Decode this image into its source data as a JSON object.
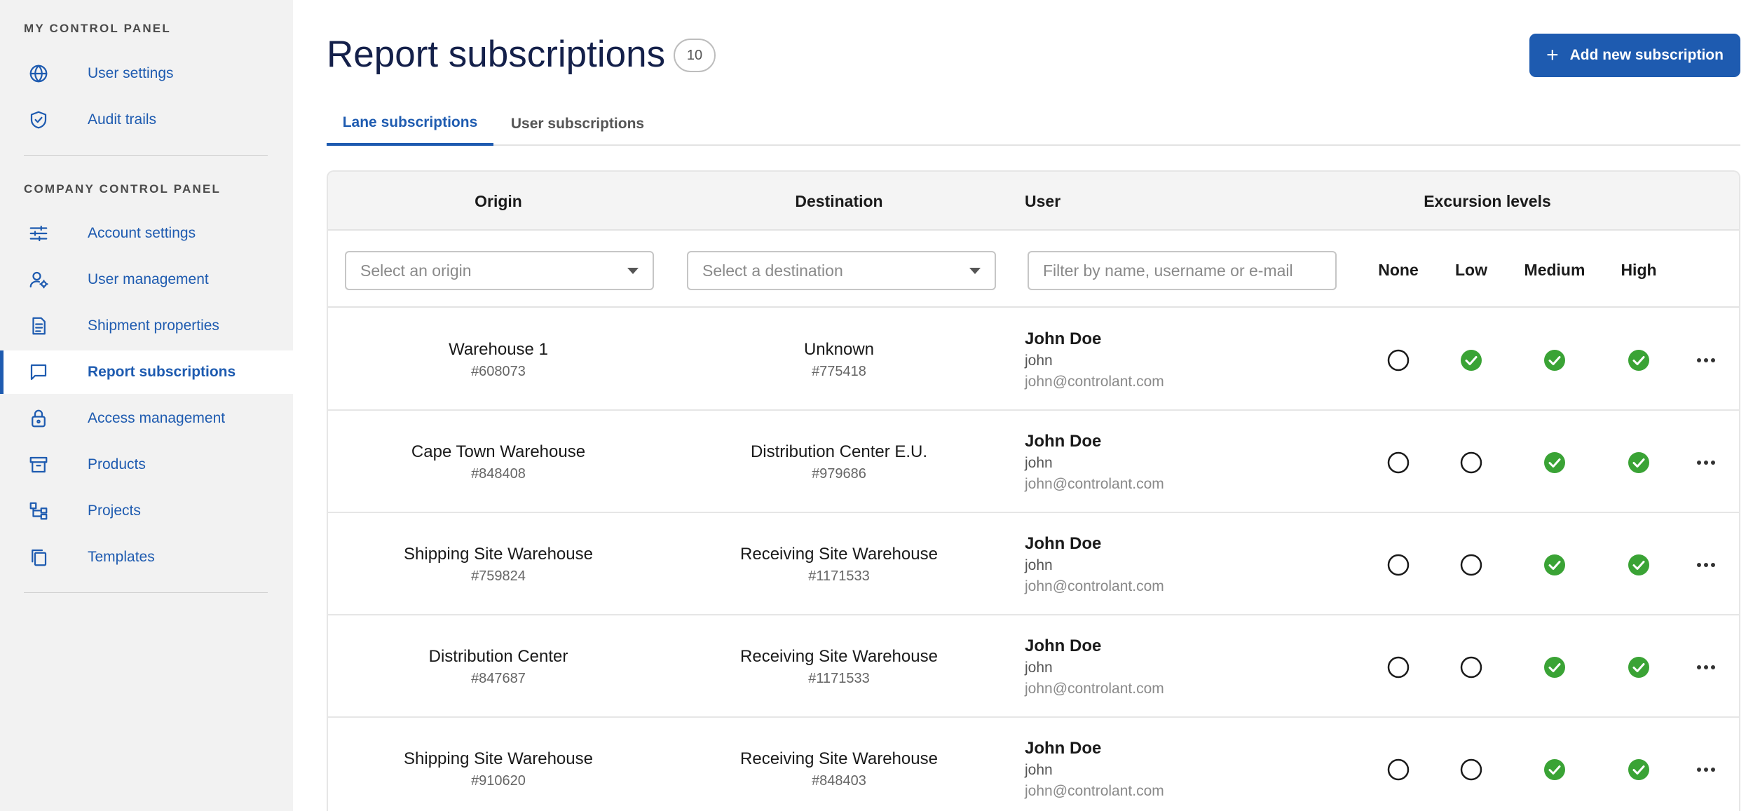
{
  "sidebar": {
    "my_section_title": "MY CONTROL PANEL",
    "my_items": [
      {
        "label": "User settings",
        "icon": "globe-icon"
      },
      {
        "label": "Audit trails",
        "icon": "shield-check-icon"
      }
    ],
    "company_section_title": "COMPANY CONTROL PANEL",
    "company_items": [
      {
        "label": "Account settings",
        "icon": "sliders-icon"
      },
      {
        "label": "User management",
        "icon": "user-gear-icon"
      },
      {
        "label": "Shipment properties",
        "icon": "document-icon"
      },
      {
        "label": "Report subscriptions",
        "icon": "message-square-icon",
        "active": true
      },
      {
        "label": "Access management",
        "icon": "lock-icon"
      },
      {
        "label": "Products",
        "icon": "archive-box-icon"
      },
      {
        "label": "Projects",
        "icon": "hierarchy-icon"
      },
      {
        "label": "Templates",
        "icon": "copy-icon"
      }
    ]
  },
  "header": {
    "title": "Report subscriptions",
    "count": "10",
    "add_button_label": "Add new subscription"
  },
  "tabs": [
    {
      "label": "Lane subscriptions",
      "active": true
    },
    {
      "label": "User subscriptions",
      "active": false
    }
  ],
  "table": {
    "columns": {
      "origin": "Origin",
      "destination": "Destination",
      "user": "User",
      "excursion": "Excursion levels"
    },
    "filters": {
      "origin_placeholder": "Select an origin",
      "destination_placeholder": "Select a destination",
      "user_placeholder": "Filter by name, username or e-mail"
    },
    "levels": [
      "None",
      "Low",
      "Medium",
      "High"
    ],
    "rows": [
      {
        "origin": "Warehouse 1",
        "origin_id": "#608073",
        "destination": "Unknown",
        "destination_id": "#775418",
        "user_name": "John Doe",
        "user_login": "john",
        "user_email": "john@controlant.com",
        "levels": {
          "none": false,
          "low": true,
          "medium": true,
          "high": true
        }
      },
      {
        "origin": "Cape Town Warehouse",
        "origin_id": "#848408",
        "destination": "Distribution Center E.U.",
        "destination_id": "#979686",
        "user_name": "John Doe",
        "user_login": "john",
        "user_email": "john@controlant.com",
        "levels": {
          "none": false,
          "low": false,
          "medium": true,
          "high": true
        }
      },
      {
        "origin": "Shipping Site Warehouse",
        "origin_id": "#759824",
        "destination": "Receiving Site Warehouse",
        "destination_id": "#1171533",
        "user_name": "John Doe",
        "user_login": "john",
        "user_email": "john@controlant.com",
        "levels": {
          "none": false,
          "low": false,
          "medium": true,
          "high": true
        }
      },
      {
        "origin": "Distribution Center",
        "origin_id": "#847687",
        "destination": "Receiving Site Warehouse",
        "destination_id": "#1171533",
        "user_name": "John Doe",
        "user_login": "john",
        "user_email": "john@controlant.com",
        "levels": {
          "none": false,
          "low": false,
          "medium": true,
          "high": true
        }
      },
      {
        "origin": "Shipping Site Warehouse",
        "origin_id": "#910620",
        "destination": "Receiving Site Warehouse",
        "destination_id": "#848403",
        "user_name": "John Doe",
        "user_login": "john",
        "user_email": "john@controlant.com",
        "levels": {
          "none": false,
          "low": false,
          "medium": true,
          "high": true
        }
      }
    ]
  },
  "colors": {
    "accent": "#1e5bb0",
    "check_green": "#3aa335",
    "title": "#14204a"
  }
}
